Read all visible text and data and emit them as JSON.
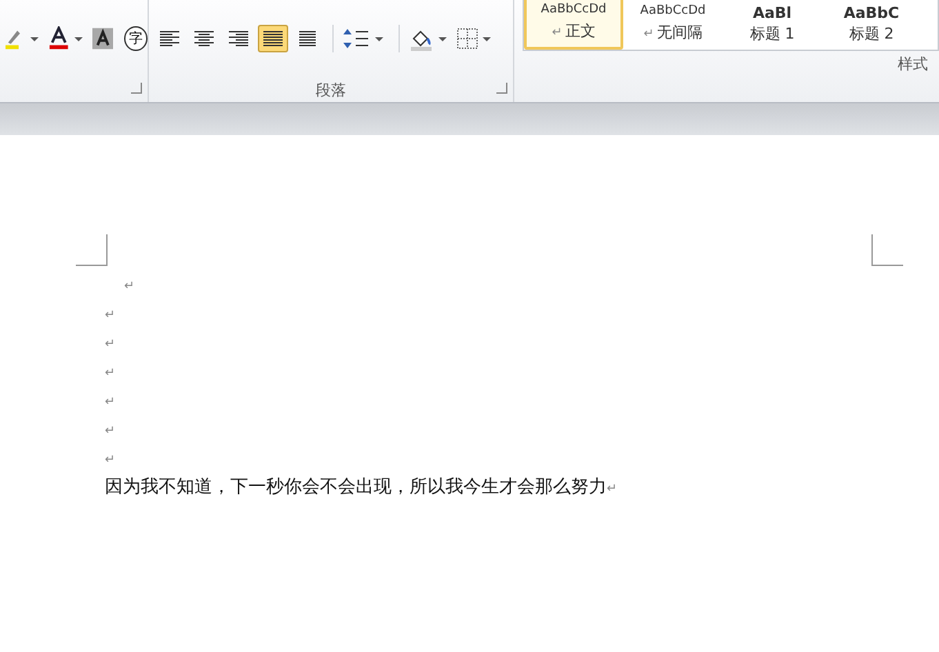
{
  "ribbon": {
    "font_group": {
      "enclosed_char": "字"
    },
    "paragraph_group": {
      "label": "段落",
      "alignments": [
        {
          "kind": "left",
          "selected": false
        },
        {
          "kind": "center",
          "selected": false
        },
        {
          "kind": "right",
          "selected": false
        },
        {
          "kind": "justify",
          "selected": true
        },
        {
          "kind": "distributed",
          "selected": false
        }
      ]
    },
    "styles_group": {
      "label": "样式",
      "styles": [
        {
          "preview": "AaBbCcDd",
          "name": "正文",
          "mark": "↵",
          "kind": "normal",
          "selected": true
        },
        {
          "preview": "AaBbCcDd",
          "name": "无间隔",
          "mark": "↵",
          "kind": "normal",
          "selected": false
        },
        {
          "preview": "AaBl",
          "name": "标题 1",
          "kind": "heading1",
          "selected": false
        },
        {
          "preview": "AaBbC",
          "name": "标题 2",
          "kind": "heading2",
          "selected": false
        }
      ]
    }
  },
  "document": {
    "paragraphs": [
      {
        "kind": "indented",
        "mark": "↵"
      },
      {
        "kind": "plain",
        "mark": "↵"
      },
      {
        "kind": "plain",
        "mark": "↵"
      },
      {
        "kind": "plain",
        "mark": "↵"
      },
      {
        "kind": "plain",
        "mark": "↵"
      },
      {
        "kind": "plain",
        "mark": "↵"
      },
      {
        "kind": "plain",
        "mark": "↵"
      },
      {
        "kind": "plain",
        "text": "因为我不知道，下一秒你会不会出现，所以我今生才会那么努力",
        "mark": "↵"
      }
    ]
  }
}
